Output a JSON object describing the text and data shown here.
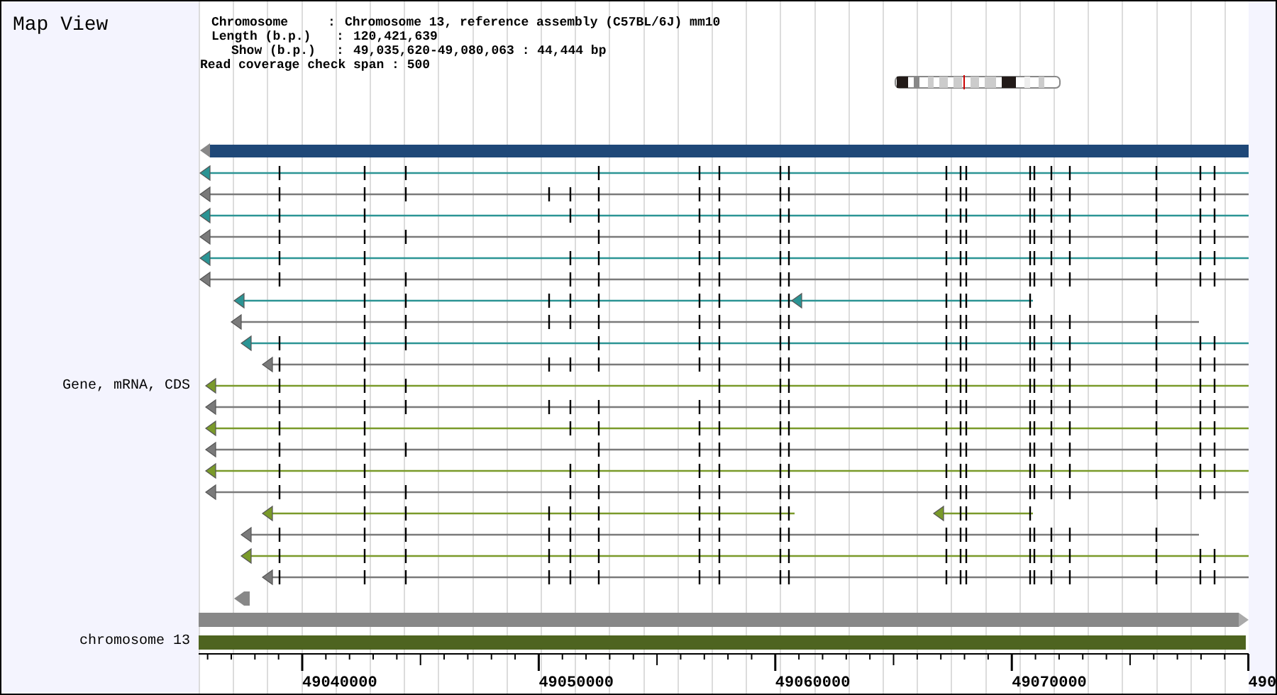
{
  "title": "Map View",
  "info": [
    {
      "label": "Chromosome",
      "separator": ":",
      "value": "Chromosome 13, reference assembly (C57BL/6J) mm10"
    },
    {
      "label": "Length (b.p.)",
      "separator": ":",
      "value": "120,421,639"
    },
    {
      "label": "Show (b.p.)",
      "separator": ":",
      "value": "49,035,620-49,080,063 : 44,444 bp"
    }
  ],
  "coverage_span": "Read coverage check span : 500",
  "track_label": "Gene, mRNA, CDS",
  "chromosome_label": "chromosome 13",
  "axis_labels": [
    "49040000",
    "49050000",
    "49060000",
    "49070000",
    "490"
  ]
}
